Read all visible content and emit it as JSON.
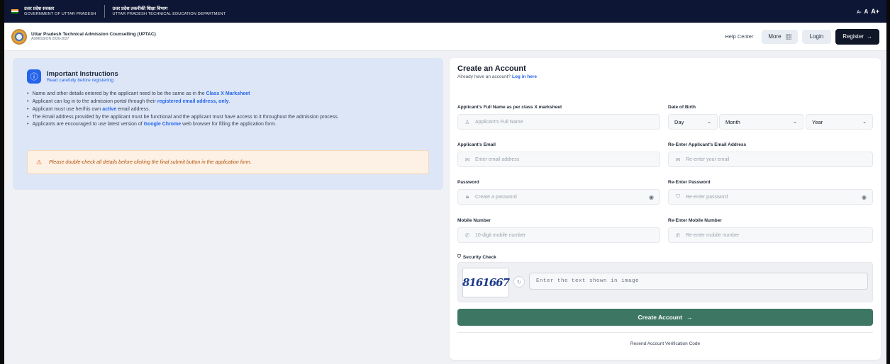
{
  "gov": {
    "state_hi": "उत्तर प्रदेश सरकार",
    "state_en": "GOVERNMENT OF UTTAR PRADESH",
    "dept_hi": "उत्तर प्रदेश तकनीकी शिक्षा विभाग",
    "dept_en": "UTTAR PRADESH TECHNICAL EDUCATION DEPARTMENT",
    "font_small": "A-",
    "font_normal": "A",
    "font_large": "A+"
  },
  "header": {
    "title": "Uttar Pradesh Technical Admission Counselling (UPTAC)",
    "subtitle": "ADMISSION 2026-2027",
    "help": "Help Center",
    "more": "More",
    "login": "Login",
    "register": "Register"
  },
  "instructions": {
    "title": "Important Instructions",
    "subtitle": "Read carefully before registering",
    "items": [
      {
        "pre": "Name and other details entered by the applicant need to be the same as in the ",
        "hl": "Class X Marksheet",
        "post": ""
      },
      {
        "pre": "Applicant can log in to the admission portal through their ",
        "hl": "registered email address, only",
        "post": "."
      },
      {
        "pre": "Applicant must use her/his own ",
        "hl": "active",
        "post": " email address."
      },
      {
        "pre": "The Email address provided by the applicant must be functional and the applicant must have access to it throughout the admission process.",
        "hl": "",
        "post": ""
      },
      {
        "pre": "Applicants are encouraged to use latest version of ",
        "hl": "Google Chrome",
        "post": " web browser for filling the application form."
      }
    ],
    "warning": "Please double-check all details before clicking the final submit button in the application form."
  },
  "form": {
    "title": "Create an Account",
    "login_prompt": "Already have an account?",
    "login_link": "Log in here",
    "name_label": "Applicant's Full Name as per class X marksheet",
    "name_placeholder": "Applicant's Full Name",
    "dob_label": "Date of Birth",
    "dob_day": "Day",
    "dob_month": "Month",
    "dob_year": "Year",
    "email_label": "Applicant's Email",
    "email_placeholder": "Enter email address",
    "email2_label": "Re-Enter Applicant's Email Address",
    "email2_placeholder": "Re-enter your email",
    "password_label": "Password",
    "password_placeholder": "Create a password",
    "password2_label": "Re-Enter Password",
    "password2_placeholder": "Re-enter password",
    "mobile_label": "Mobile Number",
    "mobile_placeholder": "10-digit mobile number",
    "mobile2_label": "Re-Enter Mobile Number",
    "mobile2_placeholder": "Re-enter mobile number",
    "security_label": "Security Check",
    "captcha_text": "8161667",
    "captcha_placeholder": "Enter the text shown in image",
    "submit": "Create Account",
    "resend": "Resend Account Verification Code"
  },
  "colors": {
    "gov_bar": "#0d1634",
    "accent": "#2563eb",
    "submit": "#3d7763",
    "instructions_bg": "#dce6f7",
    "warning_bg": "#fdf0e4"
  }
}
